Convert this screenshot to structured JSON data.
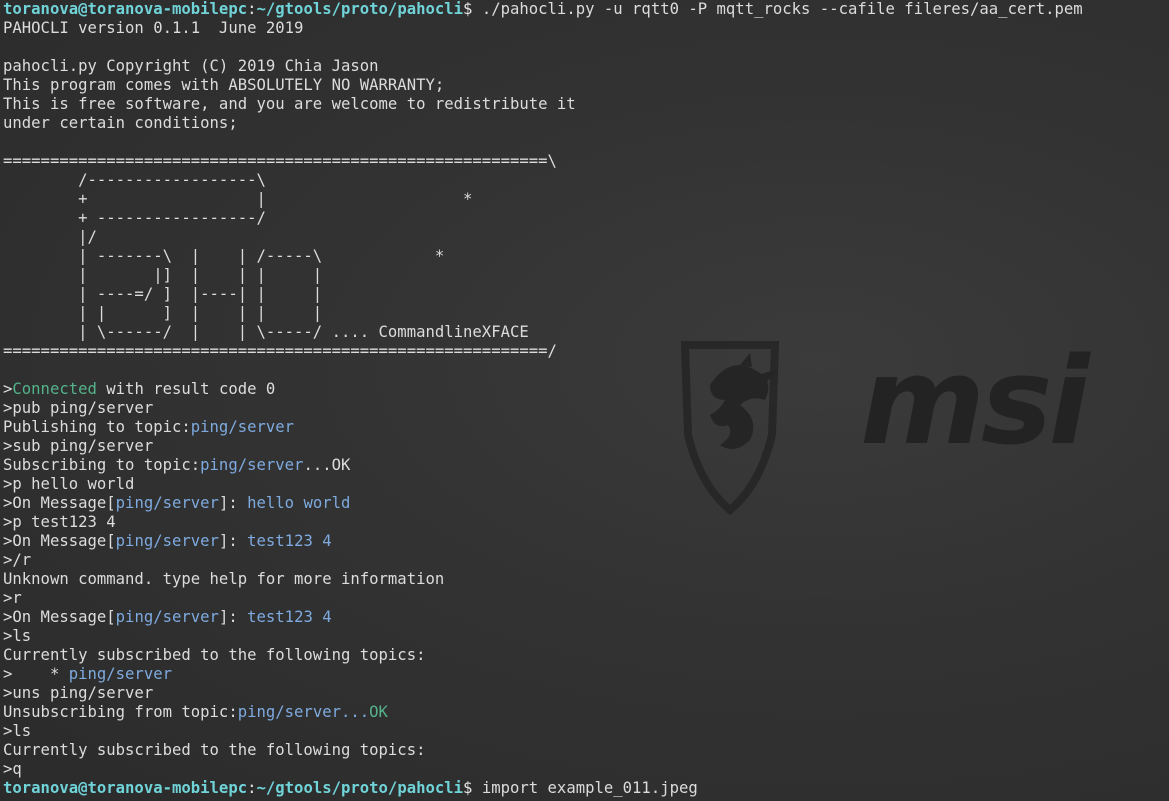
{
  "colors": {
    "background": "#323232",
    "text": "#dcdcdc",
    "prompt": "#6fd3d8",
    "connected": "#53b38a",
    "topic": "#7eaadf"
  },
  "wallpaper": {
    "logo_icon": "msi-dragon-shield-icon",
    "brand_text": "msi"
  },
  "prompt": {
    "user_host": "toranova@toranova-mobilepc",
    "colon": ":",
    "path": "~/gtools/proto/pahocli",
    "symbol": "$ "
  },
  "first_command": "./pahocli.py -u rqtt0 -P mqtt_rocks --cafile fileres/aa_cert.pem",
  "last_command": "import example_011.jpeg",
  "banner": [
    "PAHOCLI version 0.1.1  June 2019",
    "",
    "pahocli.py Copyright (C) 2019 Chia Jason",
    "This program comes with ABSOLUTELY NO WARRANTY;",
    "This is free software, and you are welcome to redistribute it",
    "under certain conditions;",
    "",
    "==========================================================\\",
    "        /------------------\\",
    "        +                  |                     *",
    "        + -----------------/",
    "        |/",
    "        | -------\\  |    | /-----\\            *",
    "        |       |]  |    | |     |",
    "        | ----=/ ]  |----| |     |",
    "        | |      ]  |    | |     |",
    "        | \\------/  |    | \\-----/ .... CommandlineXFACE",
    "==========================================================/",
    ""
  ],
  "session": {
    "connected_prefix": ">",
    "connected_word": "Connected",
    "connected_rest": " with result code 0",
    "cmd_pub": ">pub ping/server",
    "publishing_prefix": "Publishing to topic:",
    "topic": "ping/server",
    "cmd_sub": ">sub ping/server",
    "subscribing_prefix": "Subscribing to topic:",
    "ok_suffix": "...OK",
    "cmd_p_hello": ">p hello world",
    "msg_prefix": ">On Message[",
    "msg_mid": "]: ",
    "msg_hello": "hello world",
    "cmd_p_test": ">p test123 4",
    "msg_test": "test123 4",
    "cmd_slash_r": ">/r",
    "unknown_command": "Unknown command. type help for more information",
    "cmd_r": ">r",
    "cmd_ls": ">ls",
    "subscribed_header": "Currently subscribed to the following topics:",
    "list_bullet": ">    * ",
    "cmd_uns": ">uns ping/server",
    "unsubscribing_prefix": "Unsubscribing from topic:",
    "ellipsis": "...",
    "ok": "OK",
    "cmd_q": ">q"
  }
}
